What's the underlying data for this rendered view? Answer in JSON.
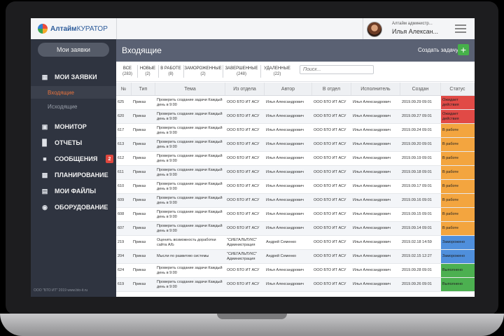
{
  "app": {
    "logo_main": "Алтайм",
    "logo_thin": "КУРАТОР",
    "user_role": "Алтайм администр...",
    "user_name": "Илья Алексан...",
    "footer": "ООО \"БТО ИТ\" 2019 www.bto-it.ru"
  },
  "sidebar": {
    "top_button": "Мои заявки",
    "items": [
      {
        "label": "МОИ ЗАЯВКИ",
        "icon": "book-icon"
      },
      {
        "label": "МОНИТОР",
        "icon": "monitor-icon"
      },
      {
        "label": "ОТЧЕТЫ",
        "icon": "bar-chart-icon"
      },
      {
        "label": "СООБЩЕНИЯ",
        "icon": "message-icon",
        "badge": "2"
      },
      {
        "label": "ПЛАНИРОВАНИЕ",
        "icon": "calendar-icon"
      },
      {
        "label": "МОИ ФАЙЛЫ",
        "icon": "files-icon"
      },
      {
        "label": "ОБОРУДОВАНИЕ",
        "icon": "globe-icon"
      }
    ],
    "sub_items": [
      "Входящие",
      "Исходящие"
    ]
  },
  "content": {
    "title": "Входящие",
    "create_label": "Создать задачу:",
    "create_btn": "+"
  },
  "filters": [
    {
      "label": "ВСЕ",
      "count": "(283)"
    },
    {
      "label": "НОВЫЕ",
      "count": "(2)"
    },
    {
      "label": "В РАБОТЕ",
      "count": "(8)"
    },
    {
      "label": "ЗАМОРОЖЕННЫЕ",
      "count": "(2)"
    },
    {
      "label": "ЗАВЕРШЕННЫЕ",
      "count": "(248)"
    },
    {
      "label": "УДАЛЕННЫЕ",
      "count": "(22)"
    }
  ],
  "search": {
    "placeholder": "Поиск..."
  },
  "table": {
    "headers": [
      "№",
      "Тип",
      "Тема",
      "Из отдела",
      "Автор",
      "В отдел",
      "Исполнитель",
      "Создан",
      "Статус"
    ],
    "rows": [
      [
        "625",
        "Приказ",
        "Проверить создание задачи Каждый день в 9:00",
        "ООО БТО ИТ АСУ",
        "Илья Александрович",
        "ООО БТО ИТ АСУ",
        "Илья Александрович",
        "2019.09.29 09:01",
        "Ожидает действия",
        "#e14a46"
      ],
      [
        "620",
        "Приказ",
        "Проверить создание задачи Каждый день в 9:00",
        "ООО БТО ИТ АСУ",
        "Илья Александрович",
        "ООО БТО ИТ АСУ",
        "Илья Александрович",
        "2019.09.27 09:01",
        "Ожидает действия",
        "#e14a46"
      ],
      [
        "617",
        "Приказ",
        "Проверить создание задачи Каждый день в 9:00",
        "ООО БТО ИТ АСУ",
        "Илья Александрович",
        "ООО БТО ИТ АСУ",
        "Илья Александрович",
        "2019.09.24 09:01",
        "В работе",
        "#f3a53f"
      ],
      [
        "613",
        "Приказ",
        "Проверить создание задачи Каждый день в 9:00",
        "ООО БТО ИТ АСУ",
        "Илья Александрович",
        "ООО БТО ИТ АСУ",
        "Илья Александрович",
        "2019.09.20 09:01",
        "В работе",
        "#f3a53f"
      ],
      [
        "612",
        "Приказ",
        "Проверить создание задачи Каждый день в 9:00",
        "ООО БТО ИТ АСУ",
        "Илья Александрович",
        "ООО БТО ИТ АСУ",
        "Илья Александрович",
        "2019.09.19 09:01",
        "В работе",
        "#f3a53f"
      ],
      [
        "611",
        "Приказ",
        "Проверить создание задачи Каждый день в 9:00",
        "ООО БТО ИТ АСУ",
        "Илья Александрович",
        "ООО БТО ИТ АСУ",
        "Илья Александрович",
        "2019.09.18 09:01",
        "В работе",
        "#f3a53f"
      ],
      [
        "610",
        "Приказ",
        "Проверить создание задачи Каждый день в 9:00",
        "ООО БТО ИТ АСУ",
        "Илья Александрович",
        "ООО БТО ИТ АСУ",
        "Илья Александрович",
        "2019.09.17 09:01",
        "В работе",
        "#f3a53f"
      ],
      [
        "609",
        "Приказ",
        "Проверить создание задачи Каждый день в 9:00",
        "ООО БТО ИТ АСУ",
        "Илья Александрович",
        "ООО БТО ИТ АСУ",
        "Илья Александрович",
        "2019.09.16 09:01",
        "В работе",
        "#f3a53f"
      ],
      [
        "608",
        "Приказ",
        "Проверить создание задачи Каждый день в 9:00",
        "ООО БТО ИТ АСУ",
        "Илья Александрович",
        "ООО БТО ИТ АСУ",
        "Илья Александрович",
        "2019.09.15 09:01",
        "В работе",
        "#f3a53f"
      ],
      [
        "607",
        "Приказ",
        "Проверить создание задачи Каждый день в 9:00",
        "ООО БТО ИТ АСУ",
        "Илья Александрович",
        "ООО БТО ИТ АСУ",
        "Илья Александрович",
        "2019.09.14 09:01",
        "В работе",
        "#f3a53f"
      ],
      [
        "219",
        "Приказ",
        "Оценить возможность доработки сайта А/Ь",
        "\"СИЕГАЛЬЛУКС\" Администрация",
        "Андрей Семенко",
        "ООО БТО ИТ АСУ",
        "Илья Александрович",
        "2019.02.18 14:59",
        "Заморожено",
        "#4f8fdc"
      ],
      [
        "204",
        "Приказ",
        "Мысли по развитию системы",
        "\"СИЕГАЛЬЛУКС\" Администрация",
        "Андрей Семенко",
        "ООО БТО ИТ АСУ",
        "Илья Александрович",
        "2019.02.15 12:27",
        "Заморожено",
        "#4f8fdc"
      ],
      [
        "624",
        "Приказ",
        "Проверить создание задачи Каждый день в 9:00",
        "ООО БТО ИТ АСУ",
        "Илья Александрович",
        "ООО БТО ИТ АСУ",
        "Илья Александрович",
        "2019.09.28 09:01",
        "Выполнено",
        "#4cb050"
      ],
      [
        "619",
        "Приказ",
        "Проверить создание задачи Каждый день в 9:00",
        "ООО БТО ИТ АСУ",
        "Илья Александрович",
        "ООО БТО ИТ АСУ",
        "Илья Александрович",
        "2019.09.26 09:01",
        "Выполнено",
        "#4cb050"
      ]
    ]
  }
}
